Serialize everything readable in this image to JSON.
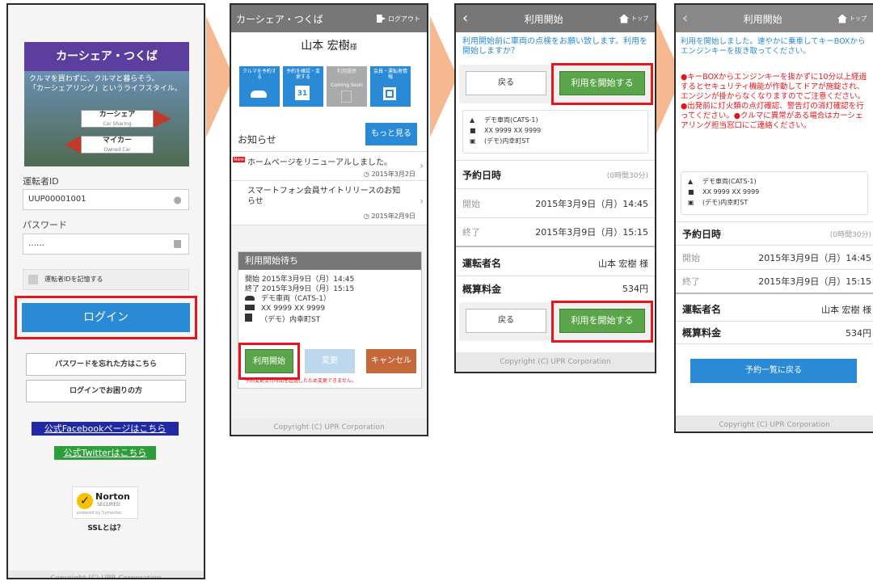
{
  "colors": {
    "accent_red": "#e8141b",
    "login_blue": "#2a8ad6",
    "brand_purple": "#5b3e9e",
    "green": "#5aa44a",
    "orange": "#c5683a",
    "arrow": "#f6b890"
  },
  "login": {
    "logo_title": "カーシェア・つくば",
    "banner_line1": "クルマを買わずに、クルマと暮らそう。",
    "banner_line2": "「カーシェアリング」というライフスタイル。",
    "sign_carshare": "カーシェア",
    "sign_carshare_sub": "Car Sharing",
    "sign_mycar": "マイカー",
    "sign_mycar_sub": "Owned Car",
    "driver_id_label": "運転者ID",
    "driver_id_value": "UUP00001001",
    "password_label": "パスワード",
    "password_value": "……",
    "remember_label": "運転者IDを記憶する",
    "login_button": "ログイン",
    "forgot_password": "パスワードを忘れた方はこちら",
    "login_help": "ログインでお困りの方",
    "facebook_link": "公式Facebookページはこちら",
    "twitter_link": "公式Twitterはこちら",
    "norton_text": "Norton",
    "norton_sub": "SECURED",
    "norton_symantec": "powered by Symantec",
    "ssl_label": "SSLとは？",
    "copyright": "Copyright (C) UPR Corporation"
  },
  "home": {
    "header_title": "カーシェア・つくば",
    "logout": "ログアウト",
    "user_name": "山本 宏樹",
    "user_suffix": "様",
    "tiles": [
      {
        "label": "クルマを予約する",
        "icon": "car-icon"
      },
      {
        "label": "予約を確認・変更する",
        "icon": "calendar-icon"
      },
      {
        "label": "利用履歴",
        "sub": "Coming Soon",
        "icon": "history-icon"
      },
      {
        "label": "会員・運転者情報",
        "icon": "profile-icon"
      }
    ],
    "calendar_day": "31",
    "news_title": "お知らせ",
    "more_button": "もっと見る",
    "news": [
      {
        "badge": "New",
        "text": "ホームページをリニューアルしました。",
        "date": "2015年3月2日"
      },
      {
        "text": "スマートフォン会員サイトリリースのお知らせ",
        "date": "2015年2月9日"
      }
    ],
    "waiting_title": "利用開始待ち",
    "start_label": "開始",
    "start_value": "2015年3月9日（月）14:45",
    "end_label": "終了",
    "end_value": "2015年3月9日（月）15:15",
    "vehicle": "デモ車両（CATS-1）",
    "plate": "XX 9999 XX 9999",
    "station": "（デモ）内幸町ST",
    "start_button": "利用開始",
    "change_button": "変更",
    "cancel_button": "キャンセル",
    "warning": "予約変更受付時間を超過したため変更できません。",
    "copyright": "Copyright (C) UPR Corporation"
  },
  "confirm": {
    "header_title": "利用開始",
    "top_label": "トップ",
    "message": "利用開始前に車両の点検をお願い致します。利用を開始しますか？",
    "back_button": "戻る",
    "start_button": "利用を開始する",
    "vehicle": "デモ車両(CATS-1)",
    "plate": "XX 9999 XX 9999",
    "station": "(デモ)内幸町ST",
    "reservation_label": "予約日時",
    "duration": "(0時間30分)",
    "start_label": "開始",
    "start_value": "2015年3月9日（月）14:45",
    "end_label": "終了",
    "end_value": "2015年3月9日（月）15:15",
    "driver_label": "運転者名",
    "driver_value": "山本 宏樹 様",
    "fee_label": "概算料金",
    "fee_value": "534円",
    "copyright": "Copyright (C) UPR Corporation"
  },
  "started": {
    "header_title": "利用開始",
    "top_label": "トップ",
    "message": "利用を開始しました。速やかに乗車してキーBOXからエンジンキーを抜き取ってください。",
    "warning": "●キーBOXからエンジンキーを抜かずに10分以上経過するとセキュリティ機能が作動してドアが施錠され、エンジンが掛からなくなりますのでご注意ください。●出発前に灯火類の点灯確認、警告灯の消灯確認を行ってください。●クルマに異常がある場合はカーシェアリング担当窓口にご連絡ください。",
    "vehicle": "デモ車両(CATS-1)",
    "plate": "XX 9999 XX 9999",
    "station": "(デモ)内幸町ST",
    "reservation_label": "予約日時",
    "duration": "(0時間30分)",
    "start_label": "開始",
    "start_value": "2015年3月9日（月）14:45",
    "end_label": "終了",
    "end_value": "2015年3月9日（月）15:15",
    "driver_label": "運転者名",
    "driver_value": "山本 宏樹 様",
    "fee_label": "概算料金",
    "fee_value": "534円",
    "back_list_button": "予約一覧に戻る",
    "copyright": "Copyright (C) UPR Corporation"
  }
}
